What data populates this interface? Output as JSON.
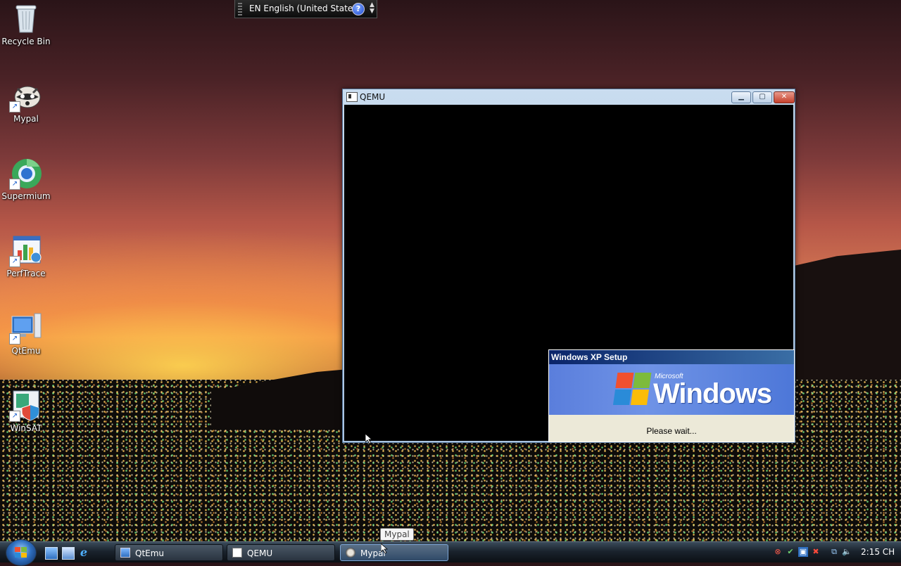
{
  "desktop": {
    "icons": [
      {
        "label": "Recycle Bin",
        "icon": "recycle-bin-icon"
      },
      {
        "label": "Mypal",
        "icon": "mypal-icon"
      },
      {
        "label": "Supermium",
        "icon": "supermium-icon"
      },
      {
        "label": "PerfTrace",
        "icon": "perftrace-icon"
      },
      {
        "label": "QtEmu",
        "icon": "qtemu-icon"
      },
      {
        "label": "WinSAT",
        "icon": "winsat-icon"
      }
    ]
  },
  "language_bar": {
    "text": "EN English (United States)",
    "help": "?"
  },
  "qemu_window": {
    "title": "QEMU",
    "setup_dialog": {
      "caption": "Windows XP Setup",
      "brand_small": "Microsoft",
      "brand_word": "Windows",
      "status": "Please wait..."
    }
  },
  "tooltip": {
    "text": "Mypal"
  },
  "taskbar": {
    "tasks": [
      {
        "label": "QtEmu",
        "icon": "qtemu-icon"
      },
      {
        "label": "QEMU",
        "icon": "qemu-icon"
      },
      {
        "label": "Mypal",
        "icon": "mypal-icon"
      }
    ],
    "clock": "2:15 CH"
  },
  "colors": {
    "taskbar": "#1a232d",
    "xp_caption": "#0a246a",
    "xp_banner": "#5a7edc",
    "close_button": "#c5402c"
  }
}
